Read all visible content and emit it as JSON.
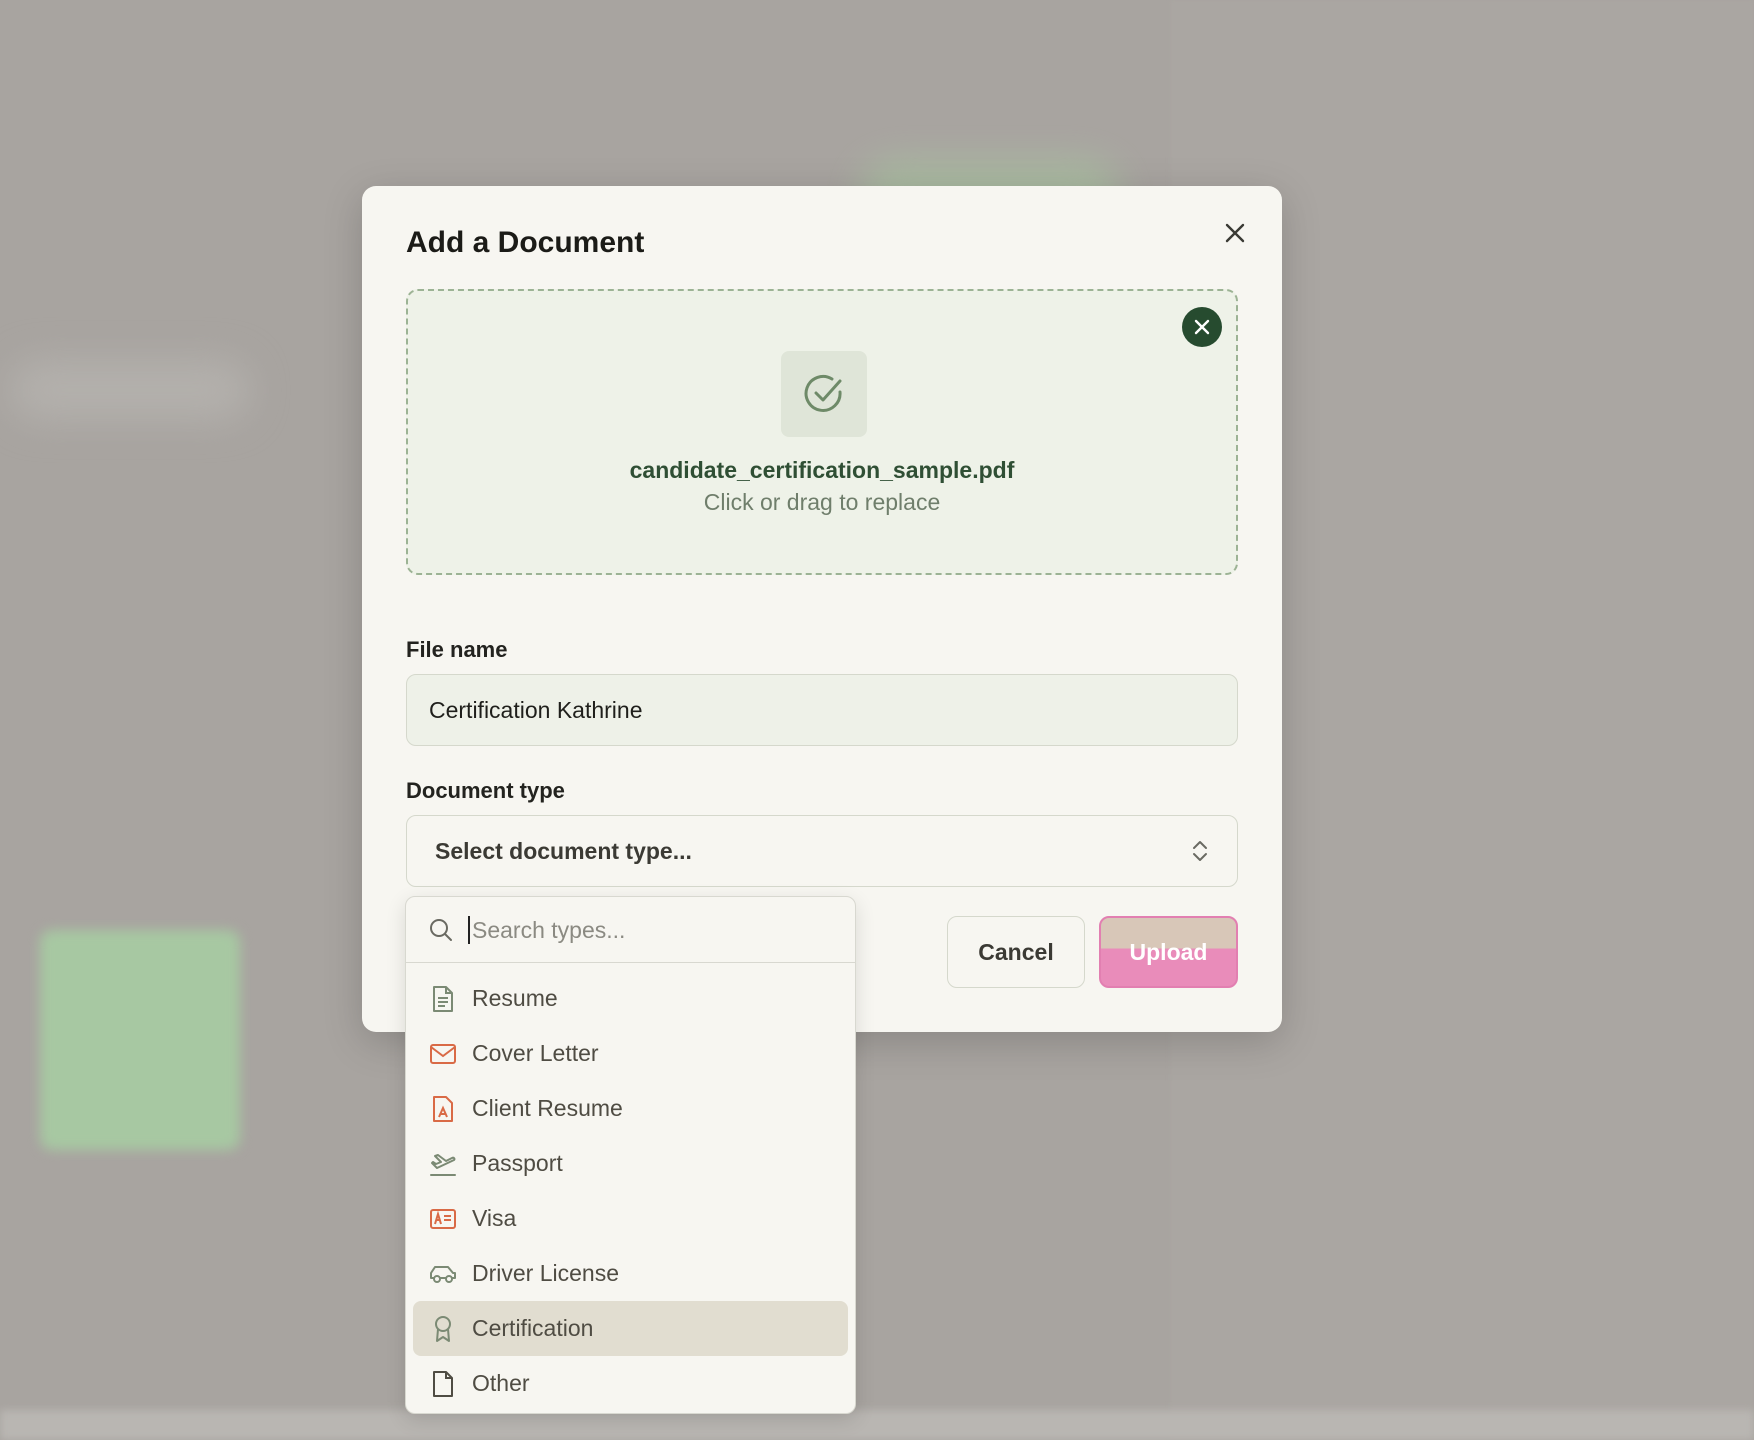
{
  "modal": {
    "title": "Add a Document",
    "dropzone": {
      "file_name": "candidate_certification_sample.pdf",
      "hint": "Click or drag to replace"
    },
    "file_name_label": "File name",
    "file_name_value": "Certification Kathrine",
    "doc_type_label": "Document type",
    "doc_type_placeholder": "Select document type...",
    "cancel_label": "Cancel",
    "upload_label": "Upload"
  },
  "dropdown": {
    "search_placeholder": "Search types...",
    "items": [
      {
        "label": "Resume",
        "icon": "document-lines-icon"
      },
      {
        "label": "Cover Letter",
        "icon": "envelope-icon"
      },
      {
        "label": "Client Resume",
        "icon": "file-person-icon"
      },
      {
        "label": "Passport",
        "icon": "plane-departure-icon"
      },
      {
        "label": "Visa",
        "icon": "id-card-icon"
      },
      {
        "label": "Driver License",
        "icon": "car-icon"
      },
      {
        "label": "Certification",
        "icon": "award-ribbon-icon",
        "selected": true
      },
      {
        "label": "Other",
        "icon": "blank-file-icon"
      }
    ]
  },
  "colors": {
    "primary_dark": "#264b2f",
    "accent_orange": "#d96a46",
    "upload_pink": "#e98cba",
    "selected_bg": "#e1ddd0"
  }
}
